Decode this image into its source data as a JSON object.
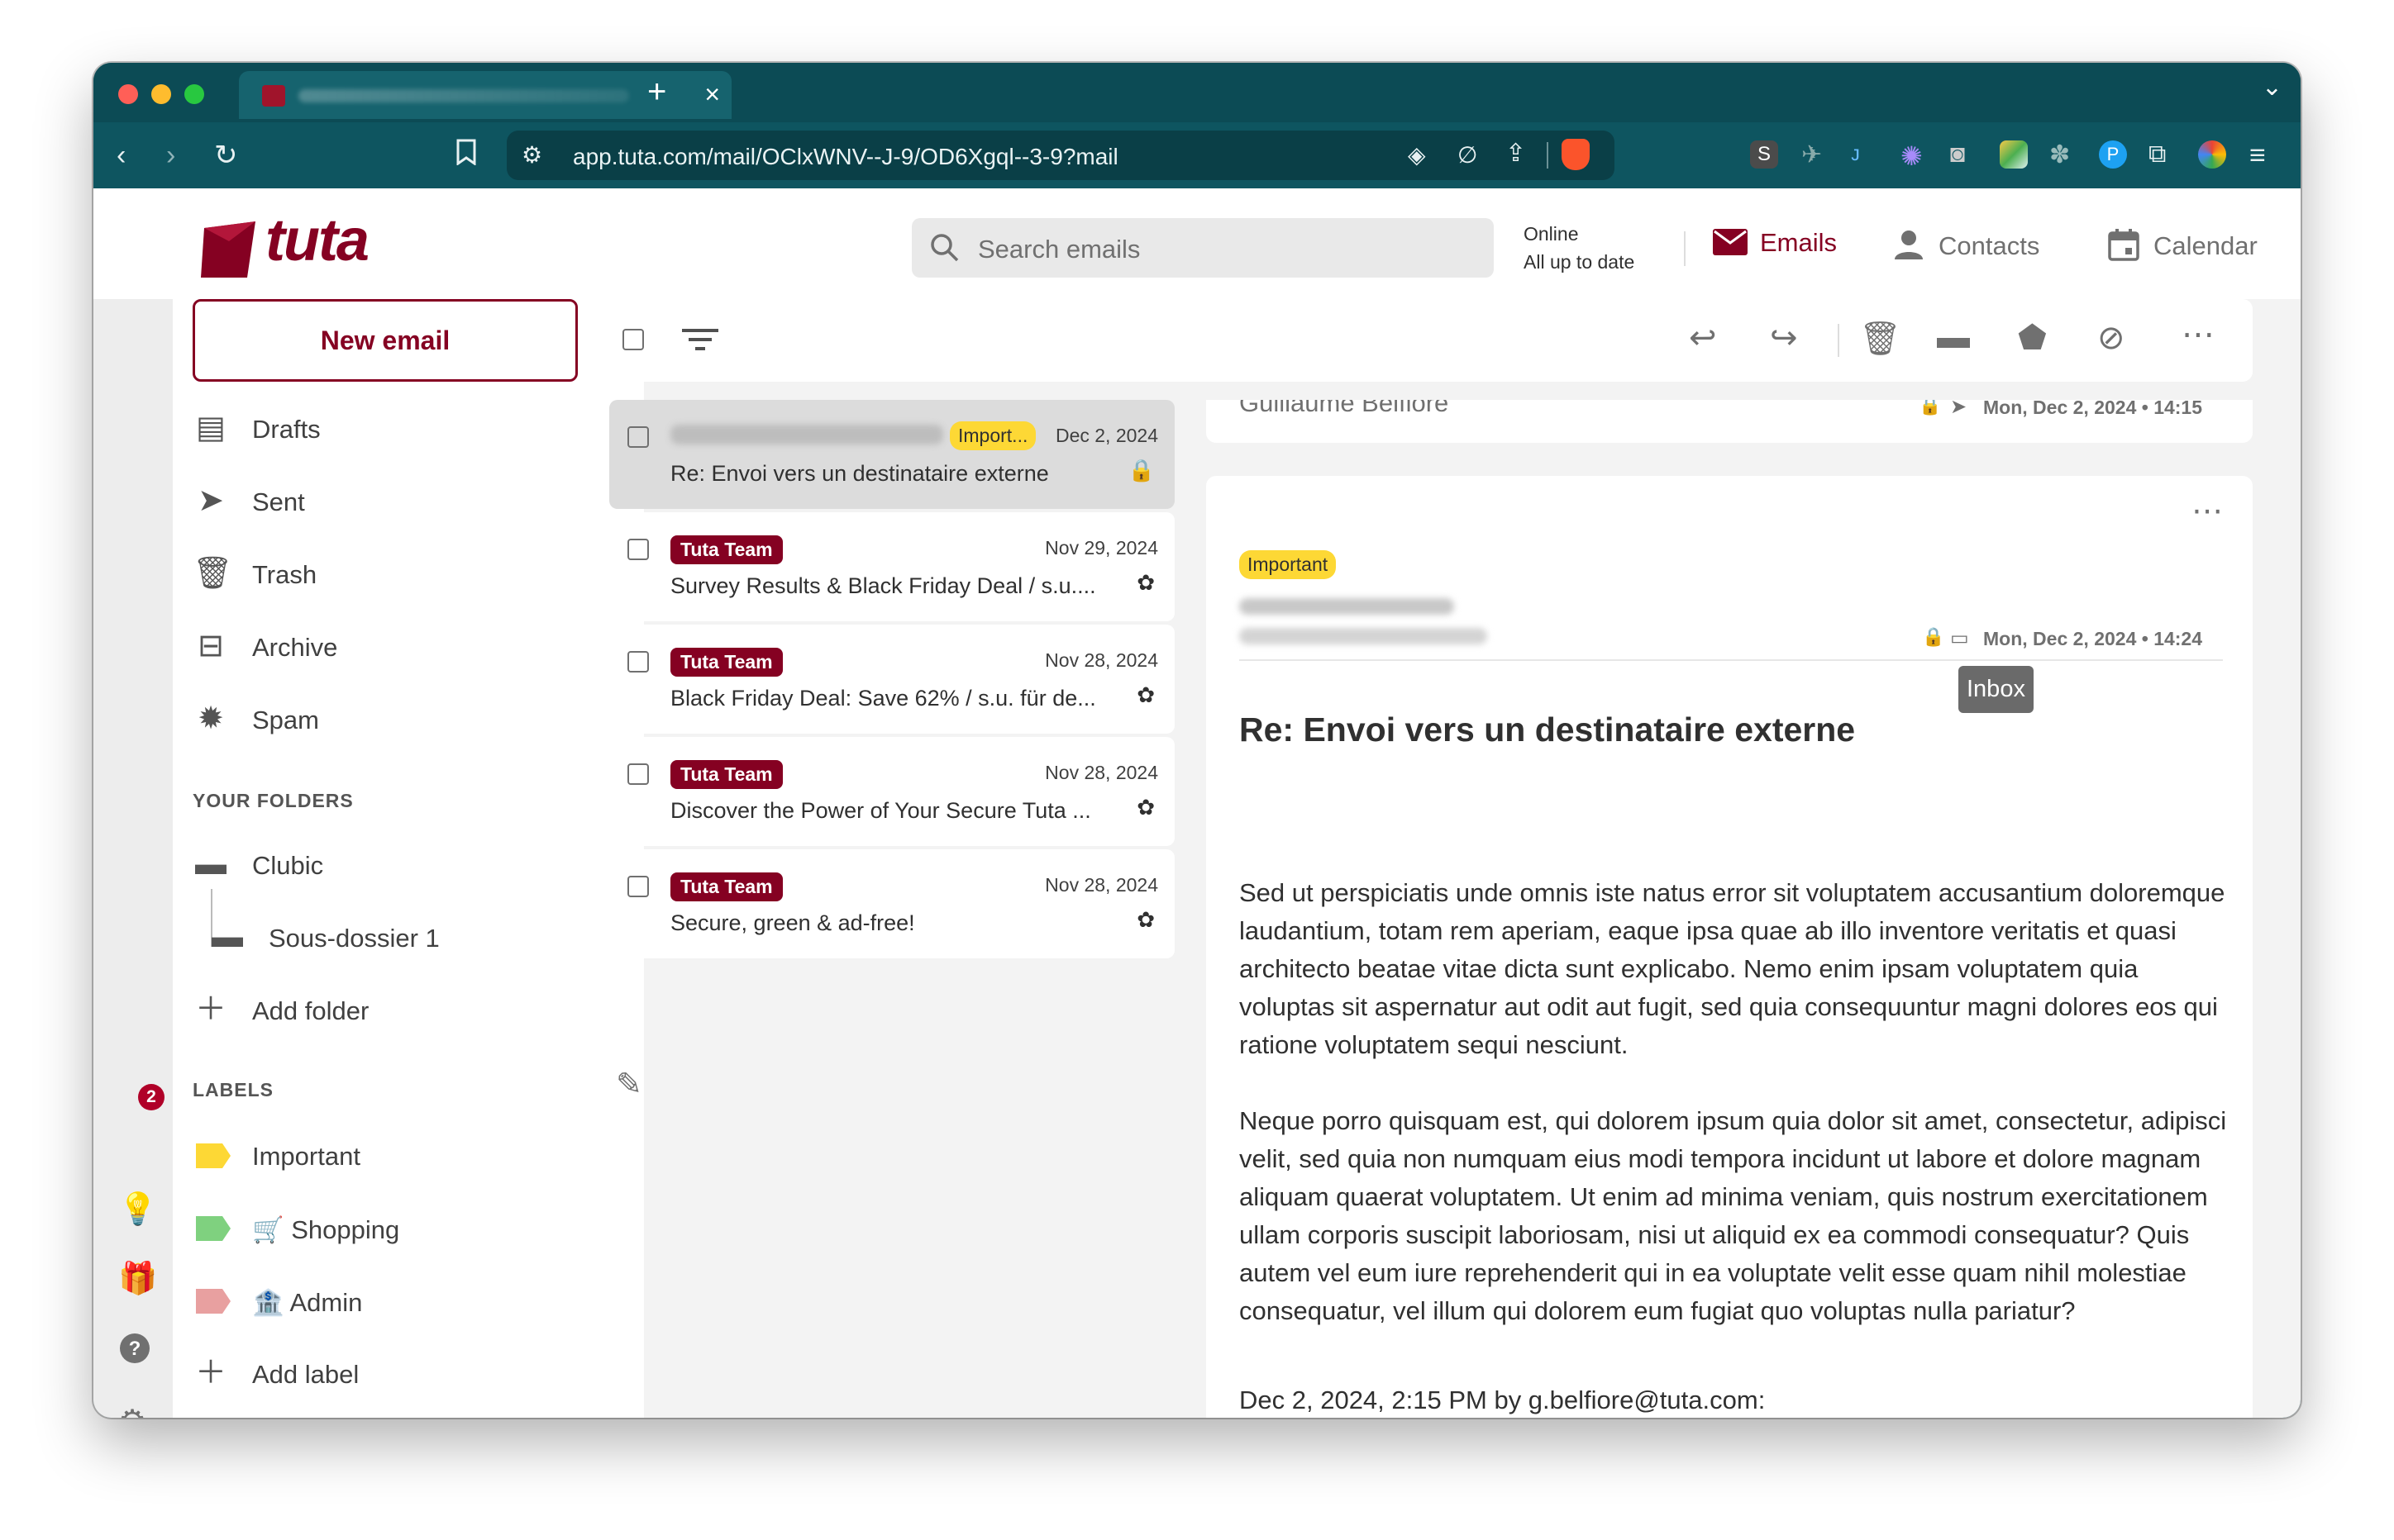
{
  "browser": {
    "url": "app.tuta.com/mail/OClxWNV--J-9/OD6Xgql--3-9?mail",
    "tab_close": "×",
    "new_tab": "+"
  },
  "header": {
    "logo_text": "tuta",
    "search_placeholder": "Search emails",
    "status_line1": "Online",
    "status_line2": "All up to date",
    "nav": {
      "emails": "Emails",
      "contacts": "Contacts",
      "calendar": "Calendar"
    }
  },
  "rail": {
    "notifications_count": "2"
  },
  "sidebar": {
    "new_email": "New email",
    "system_folders": [
      "Drafts",
      "Sent",
      "Trash",
      "Archive",
      "Spam"
    ],
    "your_folders_title": "YOUR FOLDERS",
    "user_folders": [
      "Clubic",
      "Sous-dossier 1"
    ],
    "add_folder": "Add folder",
    "labels_title": "LABELS",
    "labels": [
      {
        "name": "Important",
        "color": "#fdd835"
      },
      {
        "name": "🛒 Shopping",
        "color": "#7fd17f"
      },
      {
        "name": "🏦 Admin",
        "color": "#e8a0a0"
      }
    ],
    "add_label": "Add label"
  },
  "mail_list": [
    {
      "sender": "",
      "tag": "Import...",
      "date": "Dec 2, 2024",
      "subject": "Re: Envoi vers un destinataire externe",
      "icon": "lock-icon",
      "selected": true
    },
    {
      "sender": "Tuta Team",
      "tag": "",
      "date": "Nov 29, 2024",
      "subject": "Survey Results & Black Friday Deal / s.u....",
      "icon": "tuta-icon",
      "selected": false
    },
    {
      "sender": "Tuta Team",
      "tag": "",
      "date": "Nov 28, 2024",
      "subject": "Black Friday Deal: Save 62% / s.u. für de...",
      "icon": "tuta-icon",
      "selected": false
    },
    {
      "sender": "Tuta Team",
      "tag": "",
      "date": "Nov 28, 2024",
      "subject": "Discover the Power of Your Secure Tuta ...",
      "icon": "tuta-icon",
      "selected": false
    },
    {
      "sender": "Tuta Team",
      "tag": "",
      "date": "Nov 28, 2024",
      "subject": "Secure, green & ad-free!",
      "icon": "tuta-icon",
      "selected": false
    }
  ],
  "reader": {
    "previous": {
      "sender": "Guillaume Belfiore",
      "date": "Mon, Dec 2, 2024 • 14:15"
    },
    "label": "Important",
    "date": "Mon, Dec 2, 2024 • 14:24",
    "tooltip": "Inbox",
    "subject": "Re: Envoi vers un destinataire externe",
    "paragraphs": [
      "Sed ut perspiciatis unde omnis iste natus error sit voluptatem accusantium doloremque laudantium, totam rem aperiam, eaque ipsa quae ab illo inventore veritatis et quasi architecto beatae vitae dicta sunt explicabo. Nemo enim ipsam voluptatem quia voluptas sit aspernatur aut odit aut fugit, sed quia consequuntur magni dolores eos qui ratione voluptatem sequi nesciunt.",
      "Neque porro quisquam est, qui dolorem ipsum quia dolor sit amet, consectetur, adipisci velit, sed quia non numquam eius modi tempora incidunt ut labore et dolore magnam aliquam quaerat voluptatem. Ut enim ad minima veniam, quis nostrum exercitationem ullam corporis suscipit laboriosam, nisi ut aliquid ex ea commodi consequatur? Quis autem vel eum iure reprehenderit qui in ea voluptate velit esse quam nihil molestiae consequatur, vel illum qui dolorem eum fugiat quo voluptas nulla pariatur?"
    ],
    "quote_line": "Dec 2, 2024, 2:15 PM by g.belfiore@tuta.com:"
  },
  "colors": {
    "brand": "#850122",
    "browser": "#0e5560",
    "important": "#fdd835"
  }
}
